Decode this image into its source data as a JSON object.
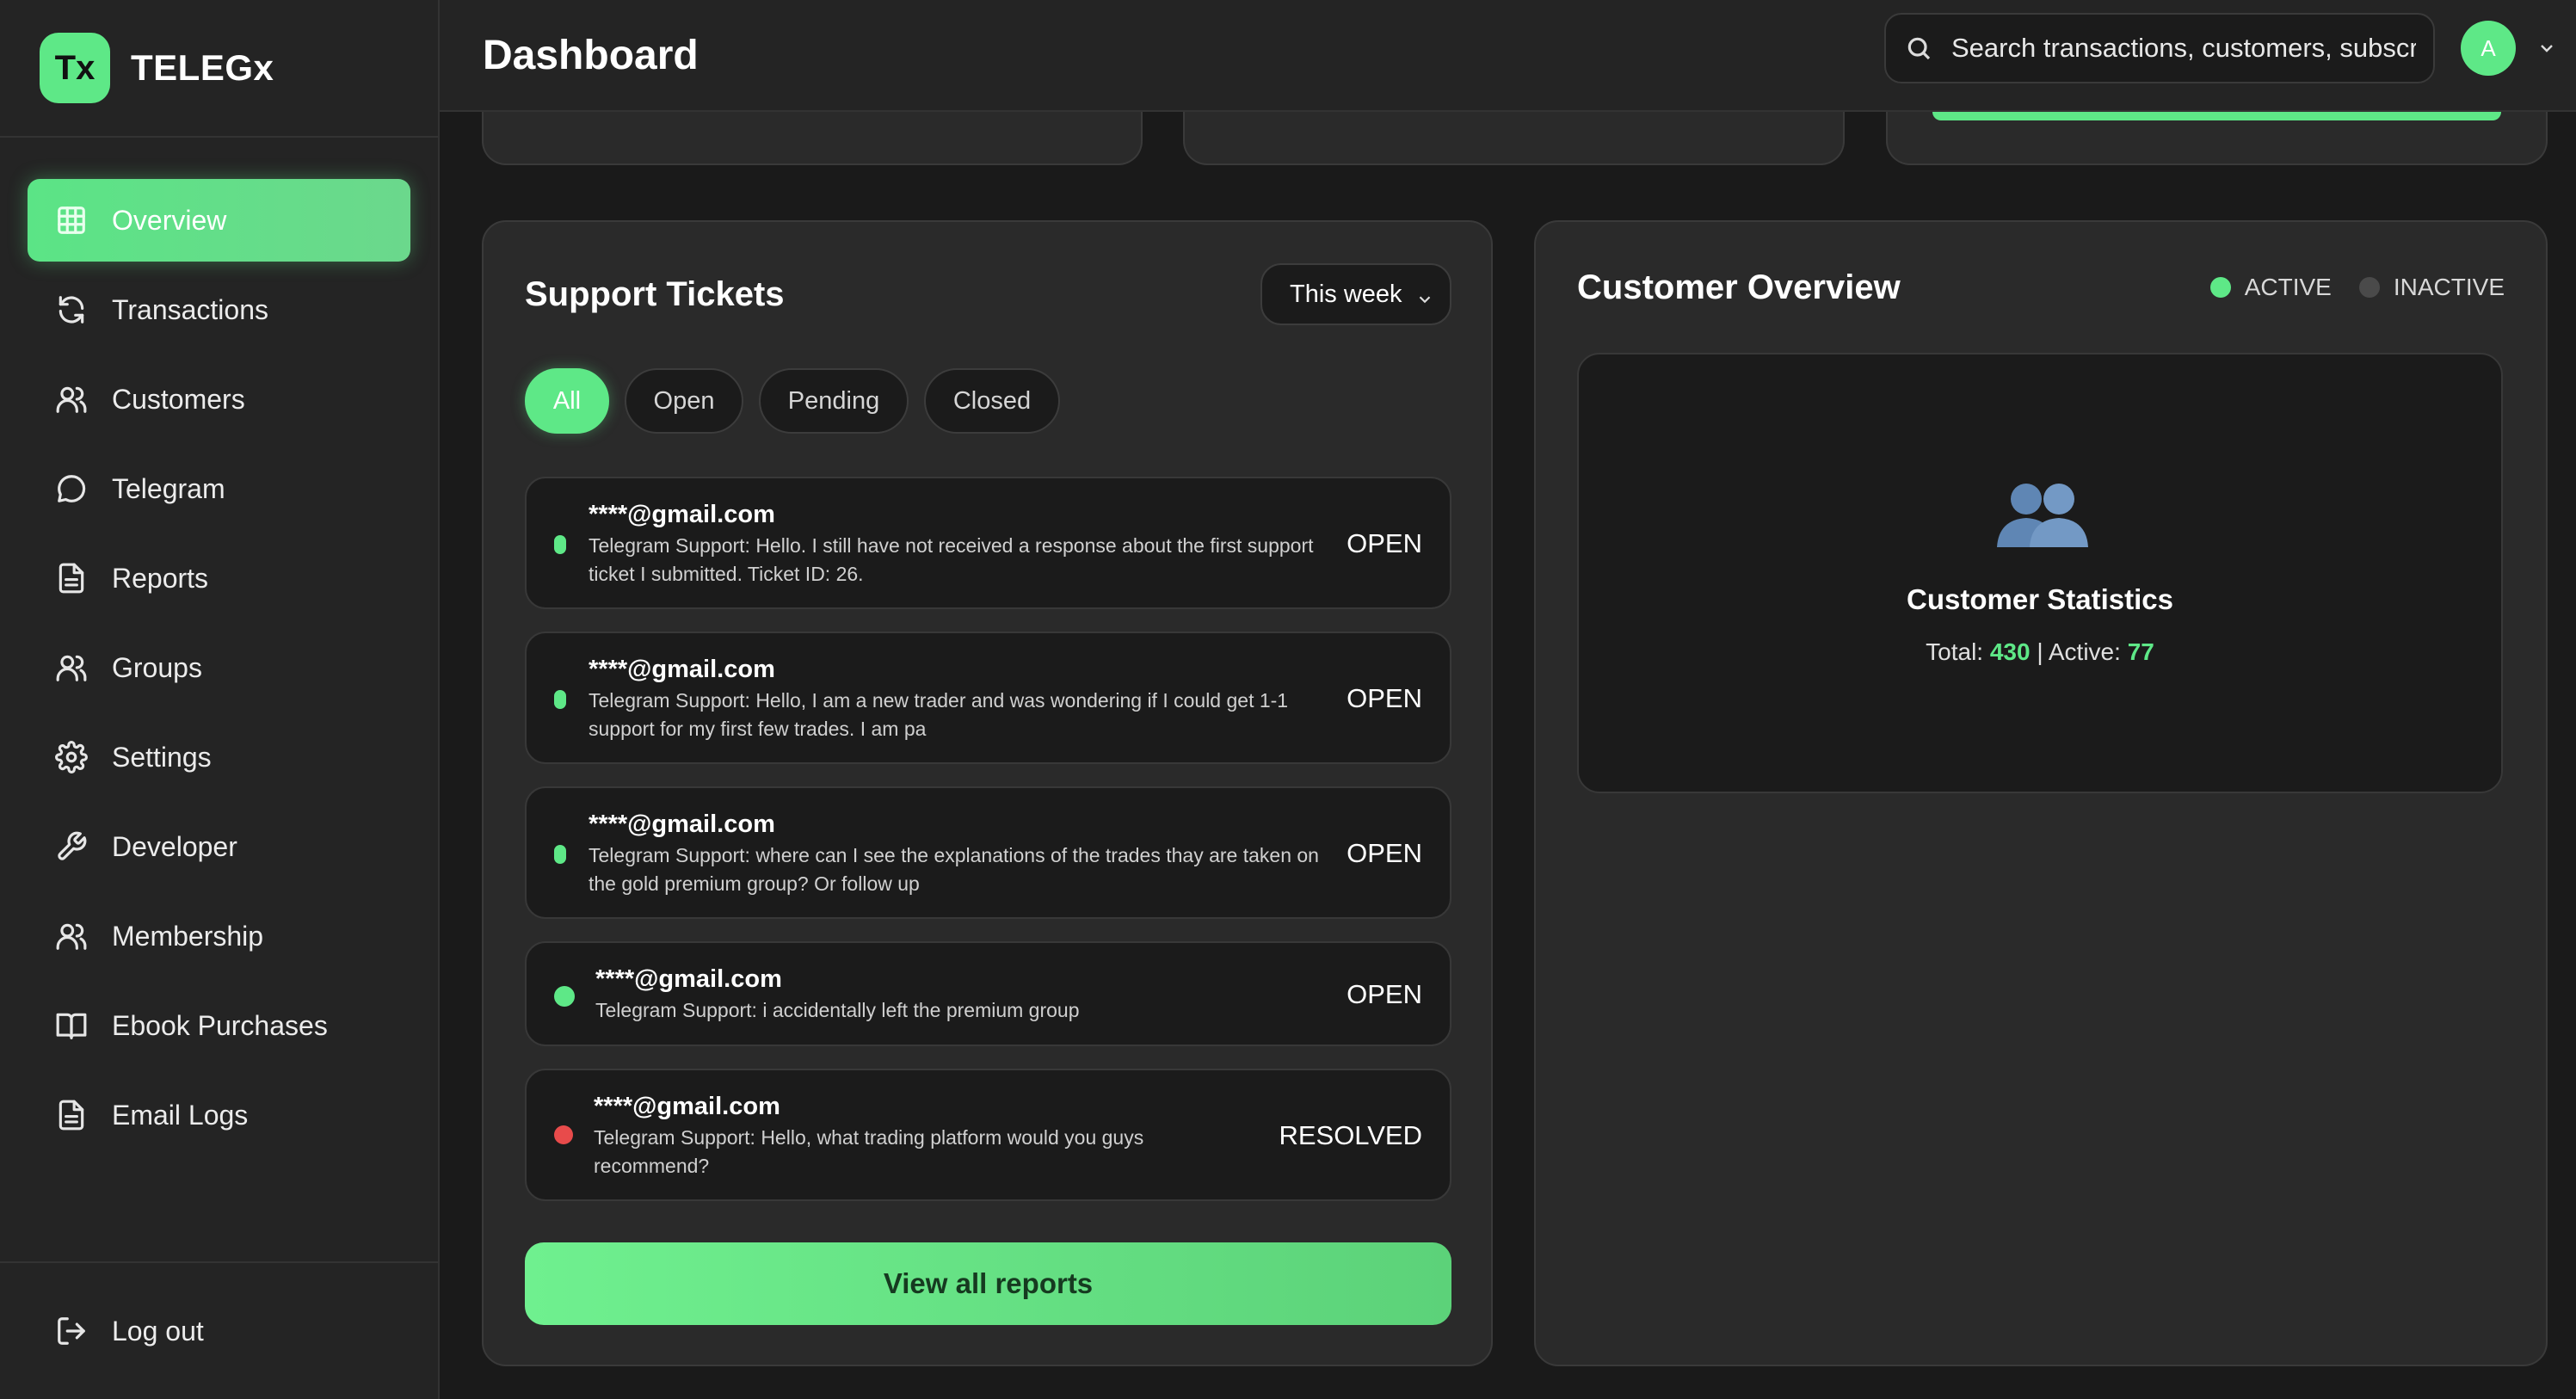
{
  "brand": {
    "logo_text": "Tx",
    "name": "TELEGx"
  },
  "colors": {
    "accent": "#5ee887",
    "danger": "#e84b4b",
    "inactive": "#4a4a4a"
  },
  "sidebar": {
    "items": [
      {
        "label": "Overview",
        "icon": "grid-icon",
        "active": true
      },
      {
        "label": "Transactions",
        "icon": "refresh-icon"
      },
      {
        "label": "Customers",
        "icon": "users-icon"
      },
      {
        "label": "Telegram",
        "icon": "chat-bubble-icon"
      },
      {
        "label": "Reports",
        "icon": "document-icon"
      },
      {
        "label": "Groups",
        "icon": "users-icon"
      },
      {
        "label": "Settings",
        "icon": "gear-icon"
      },
      {
        "label": "Developer",
        "icon": "wrench-icon"
      },
      {
        "label": "Membership",
        "icon": "users-icon"
      },
      {
        "label": "Ebook Purchases",
        "icon": "book-icon"
      },
      {
        "label": "Email Logs",
        "icon": "document-icon"
      }
    ],
    "logout_label": "Log out"
  },
  "header": {
    "title": "Dashboard",
    "search_placeholder": "Search transactions, customers, subscriptions...",
    "avatar_initial": "A"
  },
  "tickets": {
    "title": "Support Tickets",
    "period": "This week",
    "filters": [
      "All",
      "Open",
      "Pending",
      "Closed"
    ],
    "active_filter": "All",
    "items": [
      {
        "email": "****@gmail.com",
        "message": "Telegram Support: Hello. I still have not received a response about the first support ticket I submitted. Ticket ID: 26.",
        "status": "OPEN"
      },
      {
        "email": "****@gmail.com",
        "message": "Telegram Support: Hello, I am a new trader and was wondering if I could get 1-1 support for my first few trades. I am pa",
        "status": "OPEN"
      },
      {
        "email": "****@gmail.com",
        "message": "Telegram Support: where can I see the explanations of the trades thay are taken on the gold premium group? Or follow up",
        "status": "OPEN"
      },
      {
        "email": "****@gmail.com",
        "message": "Telegram Support: i accidentally left the premium group",
        "status": "OPEN"
      },
      {
        "email": "****@gmail.com",
        "message": "Telegram Support: Hello, what trading platform would you guys recommend?",
        "status": "RESOLVED"
      }
    ],
    "view_all_label": "View all reports"
  },
  "customers": {
    "title": "Customer Overview",
    "legend": {
      "active": "ACTIVE",
      "inactive": "INACTIVE"
    },
    "stats_title": "Customer Statistics",
    "total_label": "Total:",
    "total_value": "430",
    "separator": "|",
    "active_label": "Active:",
    "active_value": "77"
  }
}
